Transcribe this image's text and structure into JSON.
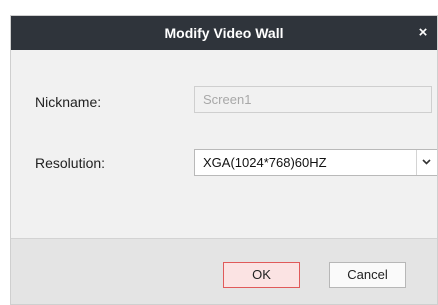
{
  "dialog": {
    "title": "Modify Video Wall",
    "close_glyph": "×"
  },
  "form": {
    "nickname_label": "Nickname:",
    "nickname_value": "Screen1",
    "resolution_label": "Resolution:",
    "resolution_value": "XGA(1024*768)60HZ"
  },
  "buttons": {
    "ok_label": "OK",
    "cancel_label": "Cancel"
  },
  "icons": {
    "close": "close-icon",
    "dropdown": "chevron-down-icon"
  },
  "colors": {
    "titlebar": "#2f343b",
    "dialog_bg": "#f1f1f1",
    "ok_border": "#e05a5a",
    "ok_bg": "#fbe3e3"
  }
}
